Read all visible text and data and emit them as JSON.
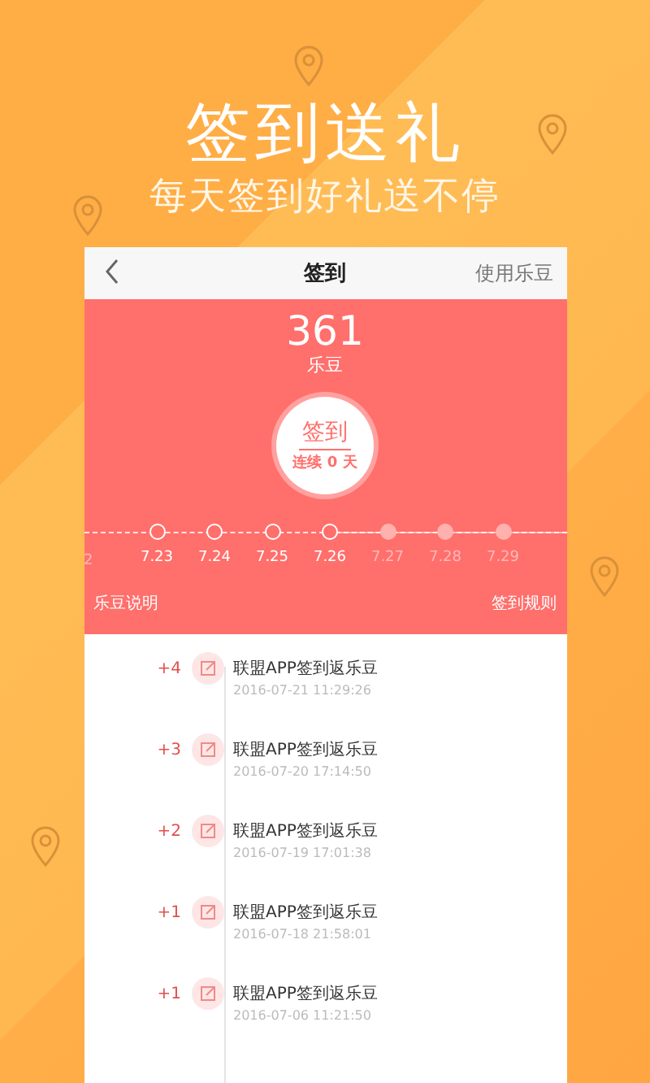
{
  "headline": "签到送礼",
  "subheadline": "每天签到好礼送不停",
  "nav": {
    "title": "签到",
    "action": "使用乐豆"
  },
  "balance": {
    "amount": "361",
    "unit": "乐豆"
  },
  "checkin_button": {
    "label": "签到",
    "streak": "连续 0 天"
  },
  "timeline": {
    "leading_label": "2",
    "days": [
      {
        "label": "7.23",
        "future": false
      },
      {
        "label": "7.24",
        "future": false
      },
      {
        "label": "7.25",
        "future": false
      },
      {
        "label": "7.26",
        "future": false
      },
      {
        "label": "7.27",
        "future": true
      },
      {
        "label": "7.28",
        "future": true
      },
      {
        "label": "7.29",
        "future": true
      }
    ]
  },
  "links": {
    "left": "乐豆说明",
    "right": "签到规则"
  },
  "records": [
    {
      "points": "+4",
      "title": "联盟APP签到返乐豆",
      "time": "2016-07-21 11:29:26"
    },
    {
      "points": "+3",
      "title": "联盟APP签到返乐豆",
      "time": "2016-07-20 17:14:50"
    },
    {
      "points": "+2",
      "title": "联盟APP签到返乐豆",
      "time": "2016-07-19 17:01:38"
    },
    {
      "points": "+1",
      "title": "联盟APP签到返乐豆",
      "time": "2016-07-18 21:58:01"
    },
    {
      "points": "+1",
      "title": "联盟APP签到返乐豆",
      "time": "2016-07-06 11:21:50"
    }
  ]
}
